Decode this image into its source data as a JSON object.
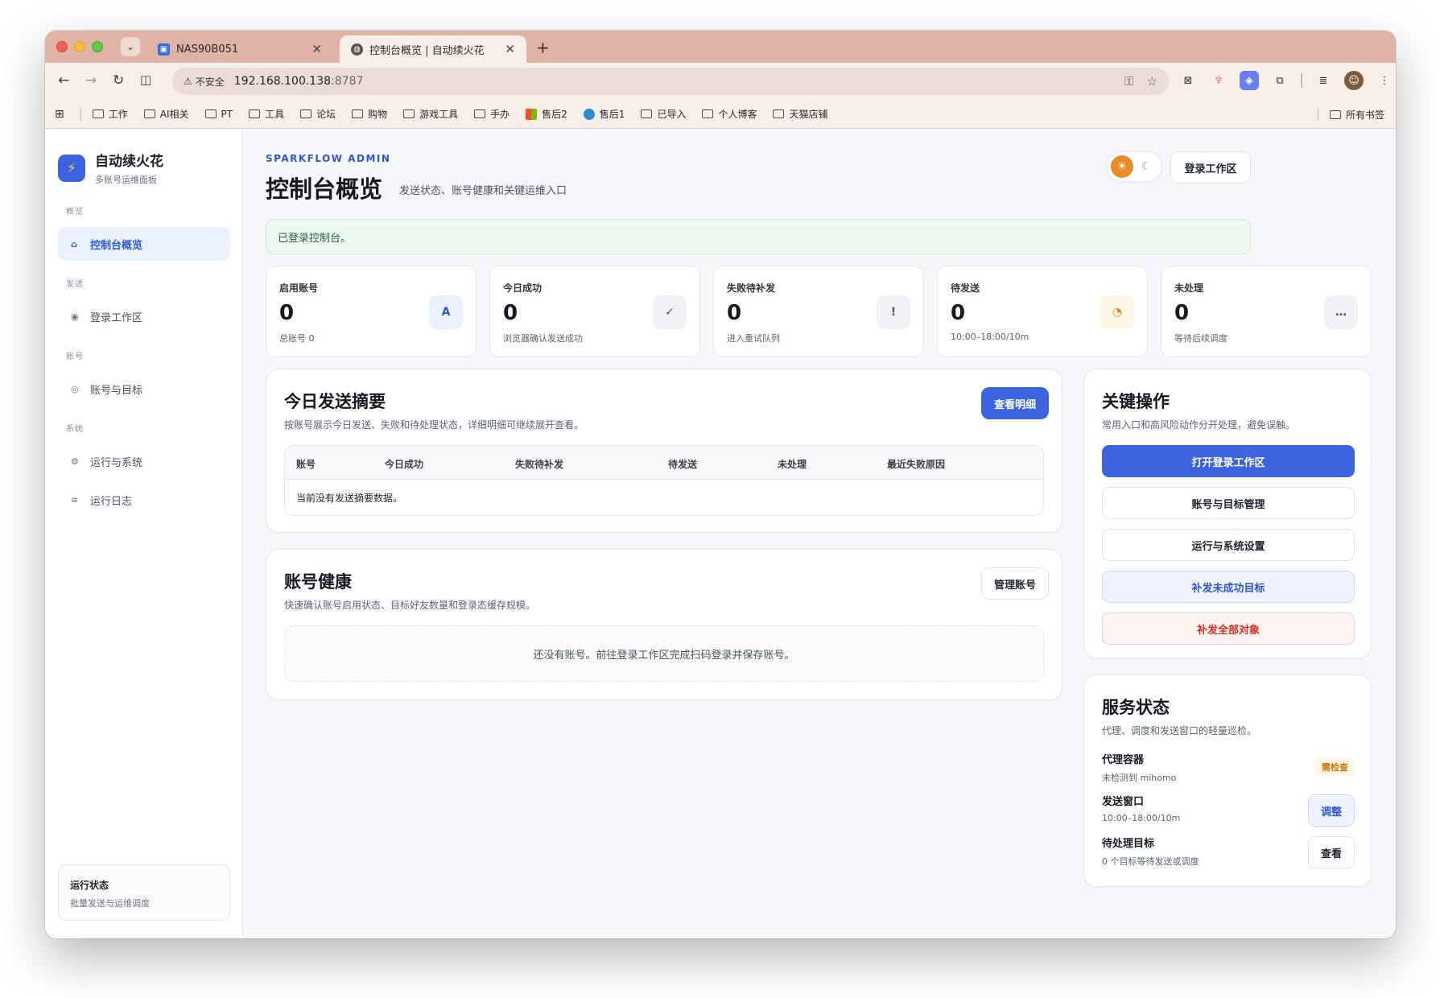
{
  "browser": {
    "tabs": [
      {
        "title": "NAS90B051"
      },
      {
        "title": "控制台概览 | 自动续火花"
      }
    ],
    "omnibox": {
      "security": "不安全",
      "host": "192.168.100.138",
      "port": ":8787"
    },
    "bookmarks": [
      "工作",
      "AI相关",
      "PT",
      "工具",
      "论坛",
      "购物",
      "游戏工具",
      "手办",
      "售后2",
      "售后1",
      "已导入",
      "个人博客",
      "天猫店铺"
    ],
    "bookmarks_right": "所有书签"
  },
  "sidebar": {
    "brand_title": "自动续火花",
    "brand_sub": "多账号运维面板",
    "sections": [
      "概览",
      "发送",
      "账号",
      "系统"
    ],
    "items": [
      {
        "label": "控制台概览",
        "icon": "⌂"
      },
      {
        "label": "登录工作区",
        "icon": "◉"
      },
      {
        "label": "账号与目标",
        "icon": "◎"
      },
      {
        "label": "运行与系统",
        "icon": "⚙"
      },
      {
        "label": "运行日志",
        "icon": "≡"
      }
    ],
    "run_card": {
      "title": "运行状态",
      "sub": "批量发送与运维调度"
    }
  },
  "header": {
    "eyebrow": "SPARKFLOW ADMIN",
    "title": "控制台概览",
    "subtitle": "发送状态、账号健康和关键运维入口",
    "login_button": "登录工作区"
  },
  "alert": "已登录控制台。",
  "stats": [
    {
      "label": "启用账号",
      "value": "0",
      "sub": "总账号 0",
      "icon": "A",
      "icon_bg": "#eaf0fe",
      "icon_color": "#3056d3"
    },
    {
      "label": "今日成功",
      "value": "0",
      "sub": "浏览器确认发送成功",
      "icon": "✓",
      "icon_bg": "#eef0f4",
      "icon_color": "#4c5262"
    },
    {
      "label": "失败待补发",
      "value": "0",
      "sub": "进入重试队列",
      "icon": "!",
      "icon_bg": "#f1f2f5",
      "icon_color": "#4c5262"
    },
    {
      "label": "待发送",
      "value": "0",
      "sub": "10:00–18:00/10m",
      "icon": "◔",
      "icon_bg": "#fff4e6",
      "icon_color": "#e08a1e"
    },
    {
      "label": "未处理",
      "value": "0",
      "sub": "等待后续调度",
      "icon": "…",
      "icon_bg": "#f1f2f5",
      "icon_color": "#4c5262"
    }
  ],
  "summary": {
    "title": "今日发送摘要",
    "sub": "按账号展示今日发送、失败和待处理状态，详细明细可继续展开查看。",
    "button": "查看明细",
    "columns": [
      "账号",
      "今日成功",
      "失败待补发",
      "待发送",
      "未处理",
      "最近失败原因"
    ],
    "empty": "当前没有发送摘要数据。"
  },
  "health": {
    "title": "账号健康",
    "sub": "快速确认账号启用状态、目标好友数量和登录态缓存规模。",
    "button": "管理账号",
    "empty": "还没有账号。前往登录工作区完成扫码登录并保存账号。"
  },
  "actions": {
    "title": "关键操作",
    "sub": "常用入口和高风险动作分开处理，避免误触。",
    "items": [
      "打开登录工作区",
      "账号与目标管理",
      "运行与系统设置",
      "补发未成功目标",
      "补发全部对象"
    ]
  },
  "services": {
    "title": "服务状态",
    "sub": "代理、调度和发送窗口的轻量巡检。",
    "rows": [
      {
        "name": "代理容器",
        "desc": "未检测到 mihomo",
        "badge": "需检查"
      },
      {
        "name": "发送窗口",
        "desc": "10:00–18:00/10m",
        "button": "调整"
      },
      {
        "name": "待处理目标",
        "desc": "0 个目标等待发送或调度",
        "button": "查看"
      }
    ]
  },
  "colors": {
    "accent": "#3d63e0",
    "success_bg": "#eef9f1",
    "danger": "#d0302a",
    "warn": "#c97a12"
  }
}
